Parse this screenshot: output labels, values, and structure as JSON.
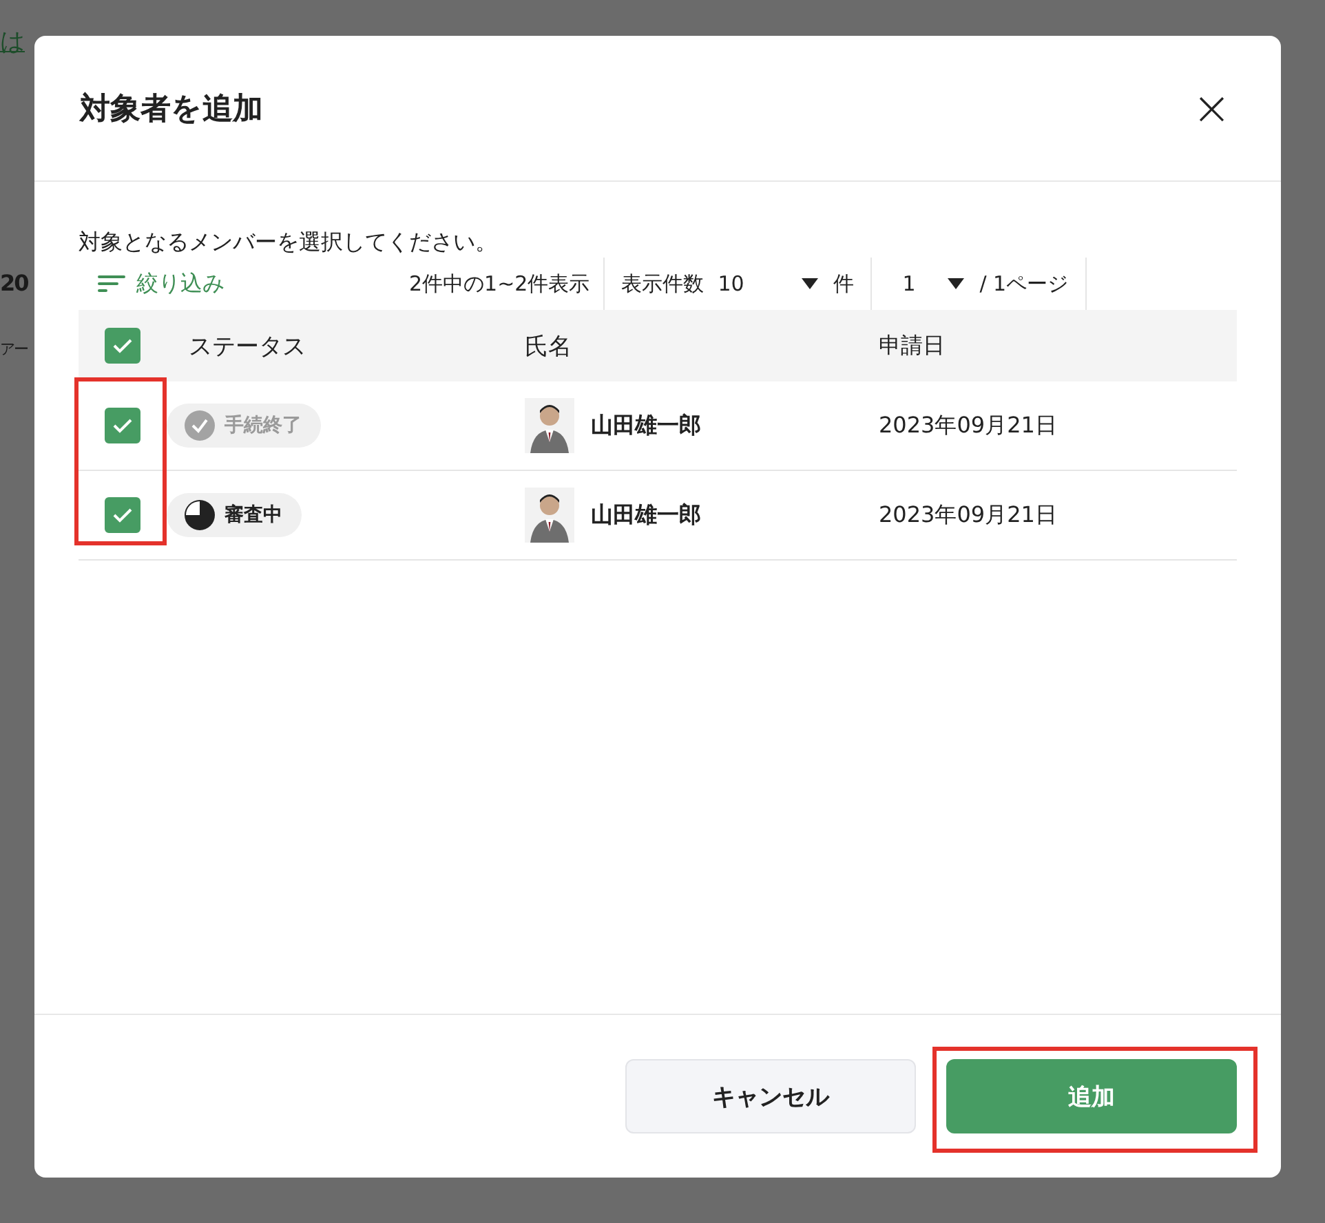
{
  "background": {
    "link": "は",
    "heading": "20",
    "label": "アー"
  },
  "dialog": {
    "title": "対象者を追加",
    "close": "×",
    "instruction": "対象となるメンバーを選択してください。"
  },
  "toolbar": {
    "filter": "絞り込み",
    "count": "2件中の1~2件表示",
    "per_page_label": "表示件数",
    "per_page_value": "10",
    "per_page_unit": "件",
    "page_value": "1",
    "page_total": "/ 1ページ"
  },
  "table": {
    "all_checked": true,
    "highlight_checkboxes": true,
    "columns": [
      "ステータス",
      "氏名",
      "申請日"
    ],
    "rows": [
      {
        "checked": true,
        "status": {
          "kind": "done",
          "label": "手続終了"
        },
        "name": "山田雄一郎",
        "date": "2023年09月21日"
      },
      {
        "checked": true,
        "status": {
          "kind": "review",
          "label": "審査中"
        },
        "name": "山田雄一郎",
        "date": "2023年09月21日"
      }
    ]
  },
  "buttons": [
    {
      "label": "キャンセル",
      "kind": "secondary",
      "highlighted": false
    },
    {
      "label": "追加",
      "kind": "primary",
      "highlighted": true
    }
  ]
}
